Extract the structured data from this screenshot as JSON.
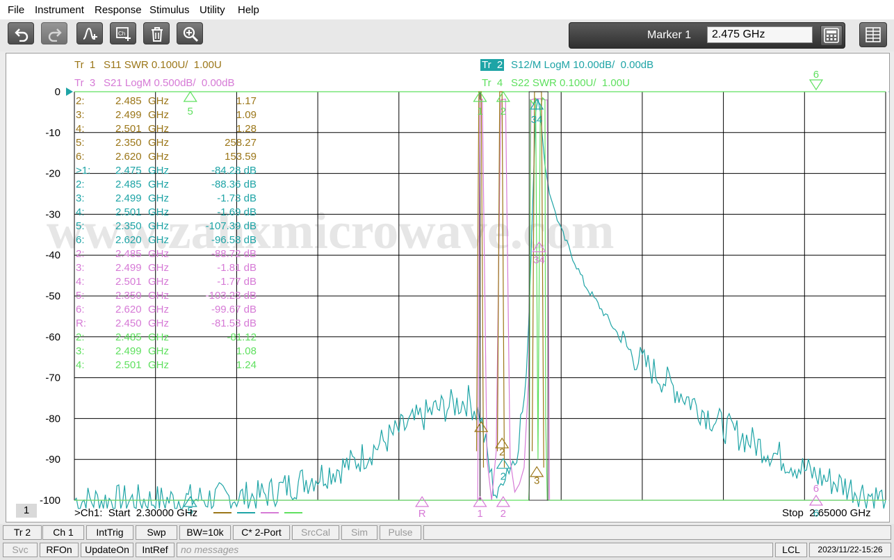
{
  "menu": [
    "File",
    "Instrument",
    "Response",
    "Stimulus",
    "Utility",
    "Help"
  ],
  "toolbar": {
    "icons": [
      "undo-icon",
      "redo-icon",
      "add-marker-icon",
      "add-channel-icon",
      "trash-icon",
      "zoom-icon"
    ],
    "marker_label": "Marker 1",
    "marker_value": "2.475 GHz",
    "calc_icon": "calculator-icon",
    "layout_icon": "grid-layout-icon"
  },
  "colors": {
    "tr1": "#9b7618",
    "tr2": "#1ea4a6",
    "tr3": "#d67ad6",
    "tr4": "#5fe05f",
    "grid": "#000000"
  },
  "traces": [
    {
      "id": "Tr  1",
      "desc": "S11 SWR 0.100U/  1.00U"
    },
    {
      "id": "Tr  2",
      "desc": "S12/M LogM 10.00dB/  0.00dB"
    },
    {
      "id": "Tr  3",
      "desc": "S21 LogM 0.500dB/  0.00dB"
    },
    {
      "id": "Tr  4",
      "desc": "S22 SWR 0.100U/  1.00U"
    }
  ],
  "marker_table": [
    {
      "n": "2:",
      "f": "2.485",
      "u": "GHz",
      "v": "1.17",
      "tr": "tr1"
    },
    {
      "n": "3:",
      "f": "2.499",
      "u": "GHz",
      "v": "1.09",
      "tr": "tr1"
    },
    {
      "n": "4:",
      "f": "2.501",
      "u": "GHz",
      "v": "1.28",
      "tr": "tr1"
    },
    {
      "n": "5:",
      "f": "2.350",
      "u": "GHz",
      "v": "258.27",
      "tr": "tr1"
    },
    {
      "n": "6:",
      "f": "2.620",
      "u": "GHz",
      "v": "153.59",
      "tr": "tr1"
    },
    {
      "n": ">1:",
      "f": "2.475",
      "u": "GHz",
      "v": "-84.28 dB",
      "tr": "tr2"
    },
    {
      "n": "2:",
      "f": "2.485",
      "u": "GHz",
      "v": "-88.36 dB",
      "tr": "tr2"
    },
    {
      "n": "3:",
      "f": "2.499",
      "u": "GHz",
      "v": "-1.73 dB",
      "tr": "tr2"
    },
    {
      "n": "4:",
      "f": "2.501",
      "u": "GHz",
      "v": "-1.69 dB",
      "tr": "tr2"
    },
    {
      "n": "5:",
      "f": "2.350",
      "u": "GHz",
      "v": "-107.39 dB",
      "tr": "tr2"
    },
    {
      "n": "6:",
      "f": "2.620",
      "u": "GHz",
      "v": "-96.58 dB",
      "tr": "tr2"
    },
    {
      "n": "2:",
      "f": "2.485",
      "u": "GHz",
      "v": "-88.72 dB",
      "tr": "tr3"
    },
    {
      "n": "3:",
      "f": "2.499",
      "u": "GHz",
      "v": "-1.81 dB",
      "tr": "tr3"
    },
    {
      "n": "4:",
      "f": "2.501",
      "u": "GHz",
      "v": "-1.77 dB",
      "tr": "tr3"
    },
    {
      "n": "5:",
      "f": "2.350",
      "u": "GHz",
      "v": "-103.23 dB",
      "tr": "tr3"
    },
    {
      "n": "6:",
      "f": "2.620",
      "u": "GHz",
      "v": "-99.67 dB",
      "tr": "tr3"
    },
    {
      "n": "R:",
      "f": "2.450",
      "u": "GHz",
      "v": "-81.53 dB",
      "tr": "tr3"
    },
    {
      "n": "2:",
      "f": "2.485",
      "u": "GHz",
      "v": "-81.12",
      "tr": "tr4"
    },
    {
      "n": "3:",
      "f": "2.499",
      "u": "GHz",
      "v": "1.08",
      "tr": "tr4"
    },
    {
      "n": "4:",
      "f": "2.501",
      "u": "GHz",
      "v": "1.24",
      "tr": "tr4"
    }
  ],
  "y_tick_labels": [
    "0",
    "-10",
    "-20",
    "-30",
    "-40",
    "-50",
    "-60",
    "-70",
    "-80",
    "-90",
    "-100"
  ],
  "top_marker_labels": [
    "1",
    "2",
    "34",
    "6",
    "5"
  ],
  "bottom_marker_labels": [
    "5",
    "R",
    "1",
    "2",
    "3",
    "34",
    "6",
    "6",
    "2",
    "2"
  ],
  "watermark": "www.zahxmicrowave.com",
  "channel_number": "1",
  "start_label": ">Ch1:  Start  2.30000 GHz",
  "stop_label": "Stop  2.65000 GHz",
  "chart_data": {
    "type": "line",
    "x_range_ghz": [
      2.3,
      2.65
    ],
    "ylim": [
      -100,
      0
    ],
    "y_ticks": [
      0,
      -10,
      -20,
      -30,
      -40,
      -50,
      -60,
      -70,
      -80,
      -90,
      -100
    ],
    "grid": true,
    "series": [
      {
        "name": "Tr 2",
        "x": [
          2.3,
          2.34,
          2.38,
          2.42,
          2.44,
          2.455,
          2.47,
          2.475,
          2.48,
          2.483,
          2.485,
          2.49,
          2.495,
          2.497,
          2.499,
          2.5,
          2.501,
          2.503,
          2.505,
          2.51,
          2.52,
          2.54,
          2.56,
          2.58,
          2.6,
          2.62,
          2.64,
          2.65
        ],
        "y": [
          -100,
          -100,
          -99,
          -91,
          -83,
          -78,
          -75.5,
          -79,
          -95,
          -100,
          -93,
          -90,
          -72,
          -40,
          -5,
          -1.7,
          -5,
          -18,
          -25,
          -34,
          -47,
          -64,
          -73,
          -82,
          -88,
          -94,
          -98,
          -100
        ]
      },
      {
        "name": "Tr 3",
        "x": [
          2.3,
          2.474,
          2.475,
          2.476,
          2.478,
          2.48,
          2.482,
          2.484,
          2.486,
          2.488,
          2.49,
          2.492,
          2.494,
          2.496,
          2.497,
          2.498,
          2.5,
          2.502,
          2.503,
          2.504,
          2.505,
          2.506,
          2.65
        ],
        "y": [
          -100,
          -100,
          -2,
          -1.8,
          -90,
          -100,
          -88,
          -2,
          -1.8,
          -90,
          -98,
          -96,
          -92,
          -70,
          -2,
          -1.8,
          -1.7,
          -1.8,
          -2,
          -2,
          -100,
          -100,
          -100
        ]
      },
      {
        "name": "Tr 4",
        "x": [
          2.3,
          2.496,
          2.4963,
          2.4967,
          2.498,
          2.499,
          2.5,
          2.501,
          2.502,
          2.503,
          2.5033,
          2.504,
          2.65
        ],
        "y": [
          -100,
          -100,
          -96,
          -2,
          -3,
          -1.5,
          -90,
          -4,
          -1.5,
          -2,
          -80,
          -100,
          -100
        ]
      }
    ]
  }
}
